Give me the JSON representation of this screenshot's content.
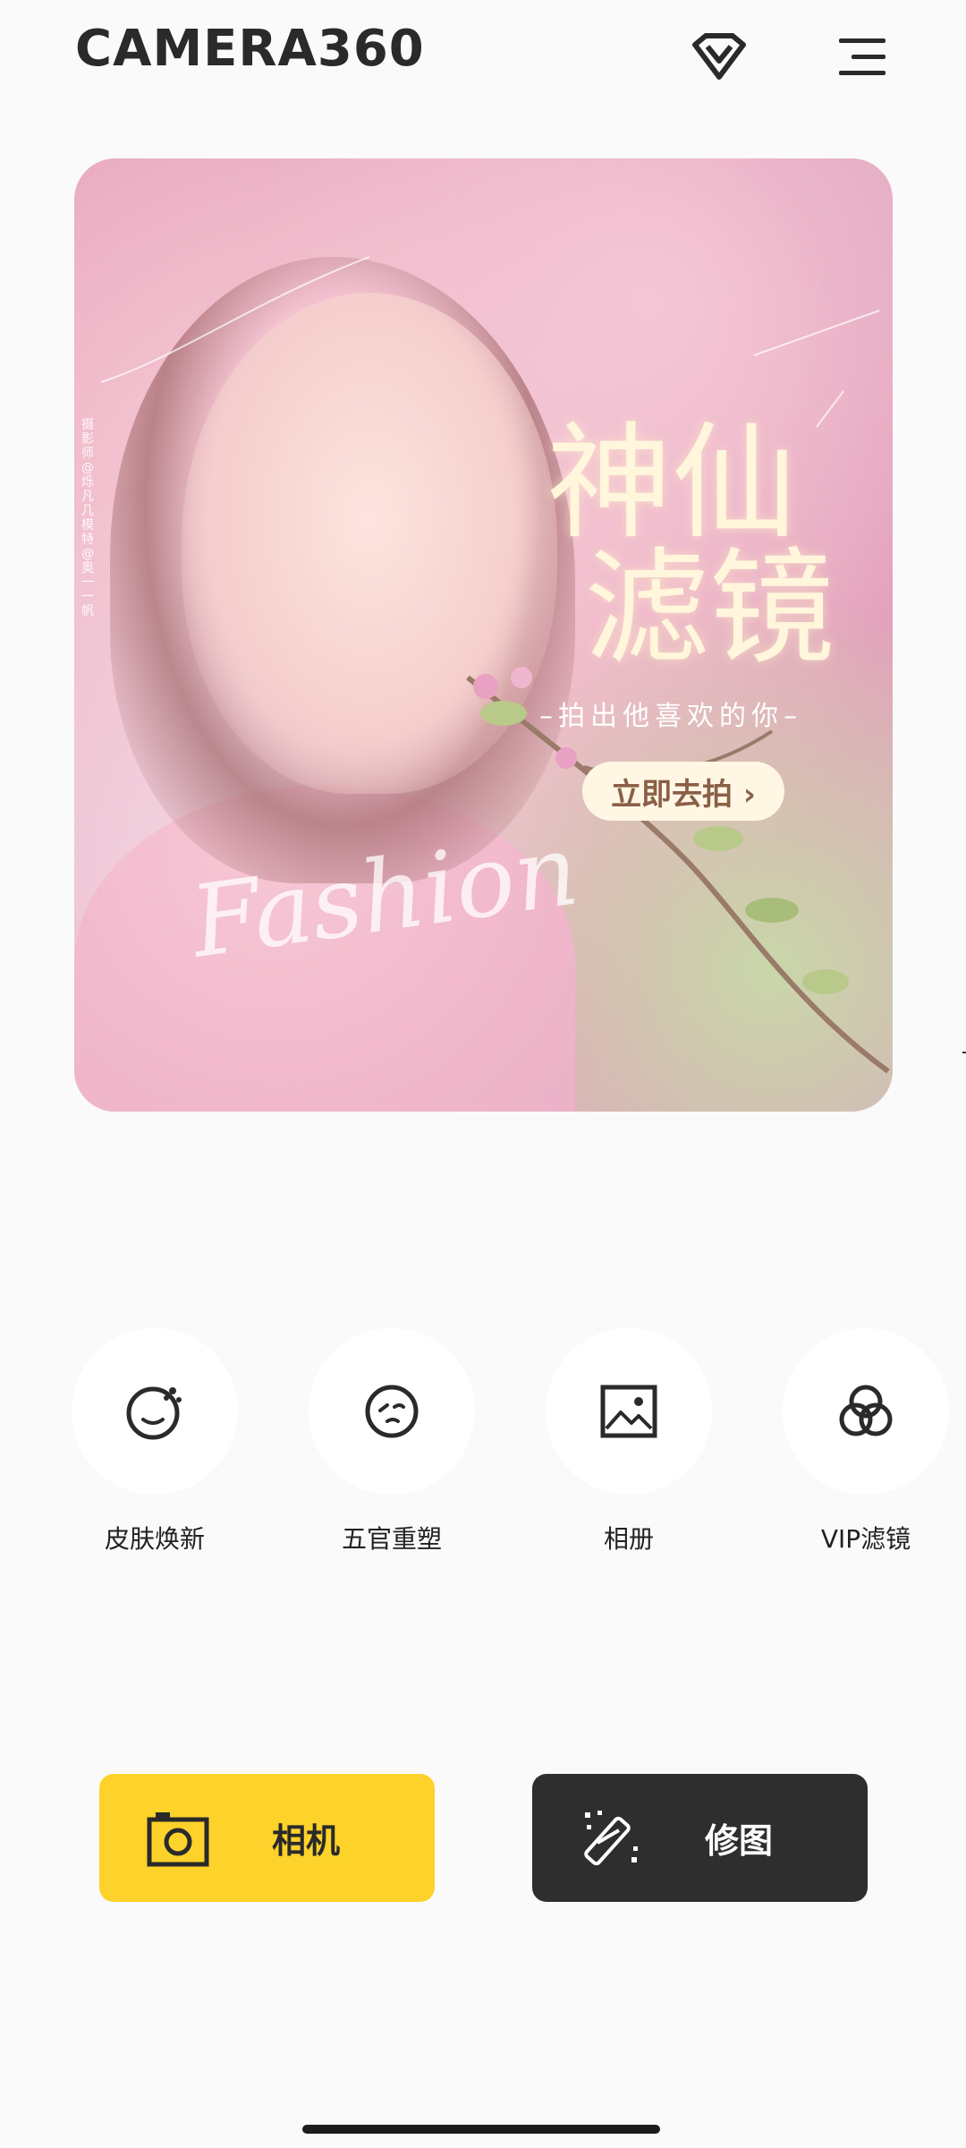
{
  "header": {
    "logo": "CAMERA360",
    "vip_icon": "diamond-icon",
    "menu_icon": "menu-icon"
  },
  "banner": {
    "title_line1": "神仙",
    "title_line2": "滤镜",
    "subtitle": "–拍出他喜欢的你–",
    "cta": "立即去拍 ›",
    "script_word": "Fashion",
    "credit": "摄影师@烁凡几 模特@奥一一帆"
  },
  "shortcuts": [
    {
      "label": "皮肤焕新",
      "icon": "face-smile-sparkle-icon"
    },
    {
      "label": "五官重塑",
      "icon": "face-reshape-icon"
    },
    {
      "label": "相册",
      "icon": "image-gallery-icon"
    },
    {
      "label": "VIP滤镜",
      "icon": "filter-circles-icon"
    }
  ],
  "actions": {
    "camera_label": "相机",
    "edit_label": "修图"
  },
  "colors": {
    "camera_bg": "#fdd22a",
    "edit_bg": "#2e2e2e",
    "page_bg": "#fafafa",
    "text_dark": "#222222"
  }
}
